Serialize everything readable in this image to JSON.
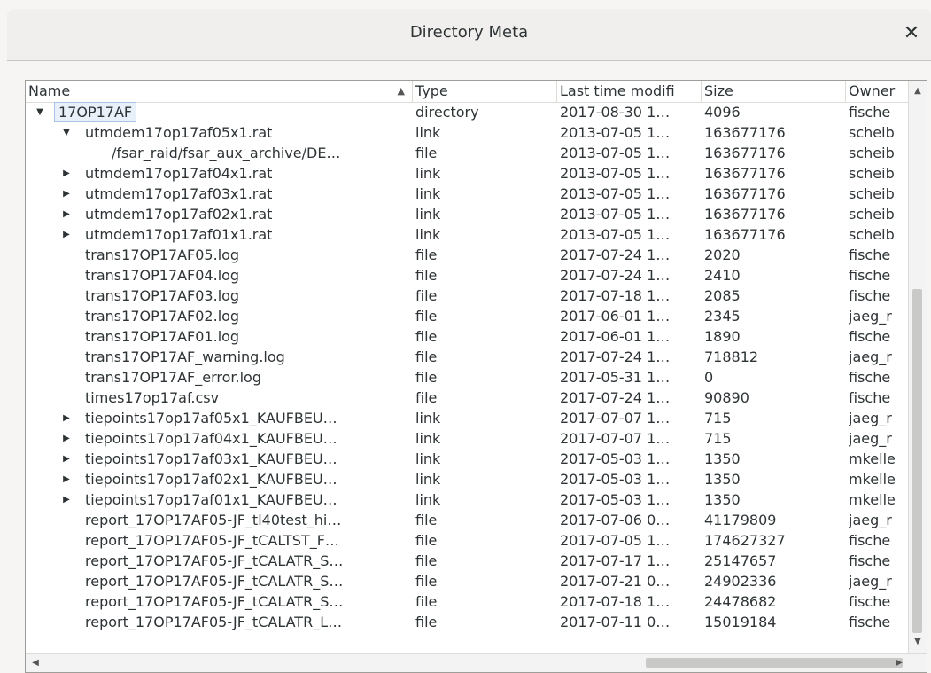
{
  "window": {
    "title": "Directory Meta",
    "close_glyph": "✕"
  },
  "columns": [
    {
      "label": "Name"
    },
    {
      "label": "Type"
    },
    {
      "label": "Last time modifi"
    },
    {
      "label": "Size"
    },
    {
      "label": "Owner"
    }
  ],
  "rows": [
    {
      "name": "17OP17AF",
      "type": "directory",
      "modified": "2017-08-30 1…",
      "size": "4096",
      "owner": "fische",
      "depth": 0,
      "expander": "expanded",
      "selected": true
    },
    {
      "name": "utmdem17op17af05x1.rat",
      "type": "link",
      "modified": "2013-07-05 1…",
      "size": "163677176",
      "owner": "scheib",
      "depth": 1,
      "expander": "expanded"
    },
    {
      "name": "/fsar_raid/fsar_aux_archive/DE…",
      "type": "file",
      "modified": "2013-07-05 1…",
      "size": "163677176",
      "owner": "scheib",
      "depth": 2,
      "expander": "none"
    },
    {
      "name": "utmdem17op17af04x1.rat",
      "type": "link",
      "modified": "2013-07-05 1…",
      "size": "163677176",
      "owner": "scheib",
      "depth": 1,
      "expander": "collapsed"
    },
    {
      "name": "utmdem17op17af03x1.rat",
      "type": "link",
      "modified": "2013-07-05 1…",
      "size": "163677176",
      "owner": "scheib",
      "depth": 1,
      "expander": "collapsed"
    },
    {
      "name": "utmdem17op17af02x1.rat",
      "type": "link",
      "modified": "2013-07-05 1…",
      "size": "163677176",
      "owner": "scheib",
      "depth": 1,
      "expander": "collapsed"
    },
    {
      "name": "utmdem17op17af01x1.rat",
      "type": "link",
      "modified": "2013-07-05 1…",
      "size": "163677176",
      "owner": "scheib",
      "depth": 1,
      "expander": "collapsed"
    },
    {
      "name": "trans17OP17AF05.log",
      "type": "file",
      "modified": "2017-07-24 1…",
      "size": "2020",
      "owner": "fische",
      "depth": 1,
      "expander": "none"
    },
    {
      "name": "trans17OP17AF04.log",
      "type": "file",
      "modified": "2017-07-24 1…",
      "size": "2410",
      "owner": "fische",
      "depth": 1,
      "expander": "none"
    },
    {
      "name": "trans17OP17AF03.log",
      "type": "file",
      "modified": "2017-07-18 1…",
      "size": "2085",
      "owner": "fische",
      "depth": 1,
      "expander": "none"
    },
    {
      "name": "trans17OP17AF02.log",
      "type": "file",
      "modified": "2017-06-01 1…",
      "size": "2345",
      "owner": "jaeg_r",
      "depth": 1,
      "expander": "none"
    },
    {
      "name": "trans17OP17AF01.log",
      "type": "file",
      "modified": "2017-06-01 1…",
      "size": "1890",
      "owner": "fische",
      "depth": 1,
      "expander": "none"
    },
    {
      "name": "trans17OP17AF_warning.log",
      "type": "file",
      "modified": "2017-07-24 1…",
      "size": "718812",
      "owner": "jaeg_r",
      "depth": 1,
      "expander": "none"
    },
    {
      "name": "trans17OP17AF_error.log",
      "type": "file",
      "modified": "2017-05-31 1…",
      "size": "0",
      "owner": "fische",
      "depth": 1,
      "expander": "none"
    },
    {
      "name": "times17op17af.csv",
      "type": "file",
      "modified": "2017-07-24 1…",
      "size": "90890",
      "owner": "fische",
      "depth": 1,
      "expander": "none"
    },
    {
      "name": "tiepoints17op17af05x1_KAUFBEU…",
      "type": "link",
      "modified": "2017-07-07 1…",
      "size": "715",
      "owner": "jaeg_r",
      "depth": 1,
      "expander": "collapsed"
    },
    {
      "name": "tiepoints17op17af04x1_KAUFBEU…",
      "type": "link",
      "modified": "2017-07-07 1…",
      "size": "715",
      "owner": "jaeg_r",
      "depth": 1,
      "expander": "collapsed"
    },
    {
      "name": "tiepoints17op17af03x1_KAUFBEU…",
      "type": "link",
      "modified": "2017-05-03 1…",
      "size": "1350",
      "owner": "mkelle",
      "depth": 1,
      "expander": "collapsed"
    },
    {
      "name": "tiepoints17op17af02x1_KAUFBEU…",
      "type": "link",
      "modified": "2017-05-03 1…",
      "size": "1350",
      "owner": "mkelle",
      "depth": 1,
      "expander": "collapsed"
    },
    {
      "name": "tiepoints17op17af01x1_KAUFBEU…",
      "type": "link",
      "modified": "2017-05-03 1…",
      "size": "1350",
      "owner": "mkelle",
      "depth": 1,
      "expander": "collapsed"
    },
    {
      "name": "report_17OP17AF05-JF_tl40test_hi…",
      "type": "file",
      "modified": "2017-07-06 0…",
      "size": "41179809",
      "owner": "jaeg_r",
      "depth": 1,
      "expander": "none"
    },
    {
      "name": "report_17OP17AF05-JF_tCALTST_F…",
      "type": "file",
      "modified": "2017-07-05 1…",
      "size": "174627327",
      "owner": "fische",
      "depth": 1,
      "expander": "none"
    },
    {
      "name": "report_17OP17AF05-JF_tCALATR_S…",
      "type": "file",
      "modified": "2017-07-17 1…",
      "size": "25147657",
      "owner": "fische",
      "depth": 1,
      "expander": "none"
    },
    {
      "name": "report_17OP17AF05-JF_tCALATR_S…",
      "type": "file",
      "modified": "2017-07-21 0…",
      "size": "24902336",
      "owner": "jaeg_r",
      "depth": 1,
      "expander": "none"
    },
    {
      "name": "report_17OP17AF05-JF_tCALATR_S…",
      "type": "file",
      "modified": "2017-07-18 1…",
      "size": "24478682",
      "owner": "fische",
      "depth": 1,
      "expander": "none"
    },
    {
      "name": "report_17OP17AF05-JF_tCALATR_L…",
      "type": "file",
      "modified": "2017-07-11 0…",
      "size": "15019184",
      "owner": "fische",
      "depth": 1,
      "expander": "none"
    }
  ],
  "icons": {
    "sort": "sort-ascending-icon",
    "expanded": "triangle-down-icon",
    "collapsed": "triangle-right-icon",
    "scroll_up": "arrow-up-icon",
    "scroll_down": "arrow-down-icon",
    "scroll_left": "arrow-left-icon",
    "scroll_right": "arrow-right-icon"
  },
  "colors": {
    "selection_border": "#a9c3e3",
    "selection_fill": "#e8f0fa"
  }
}
